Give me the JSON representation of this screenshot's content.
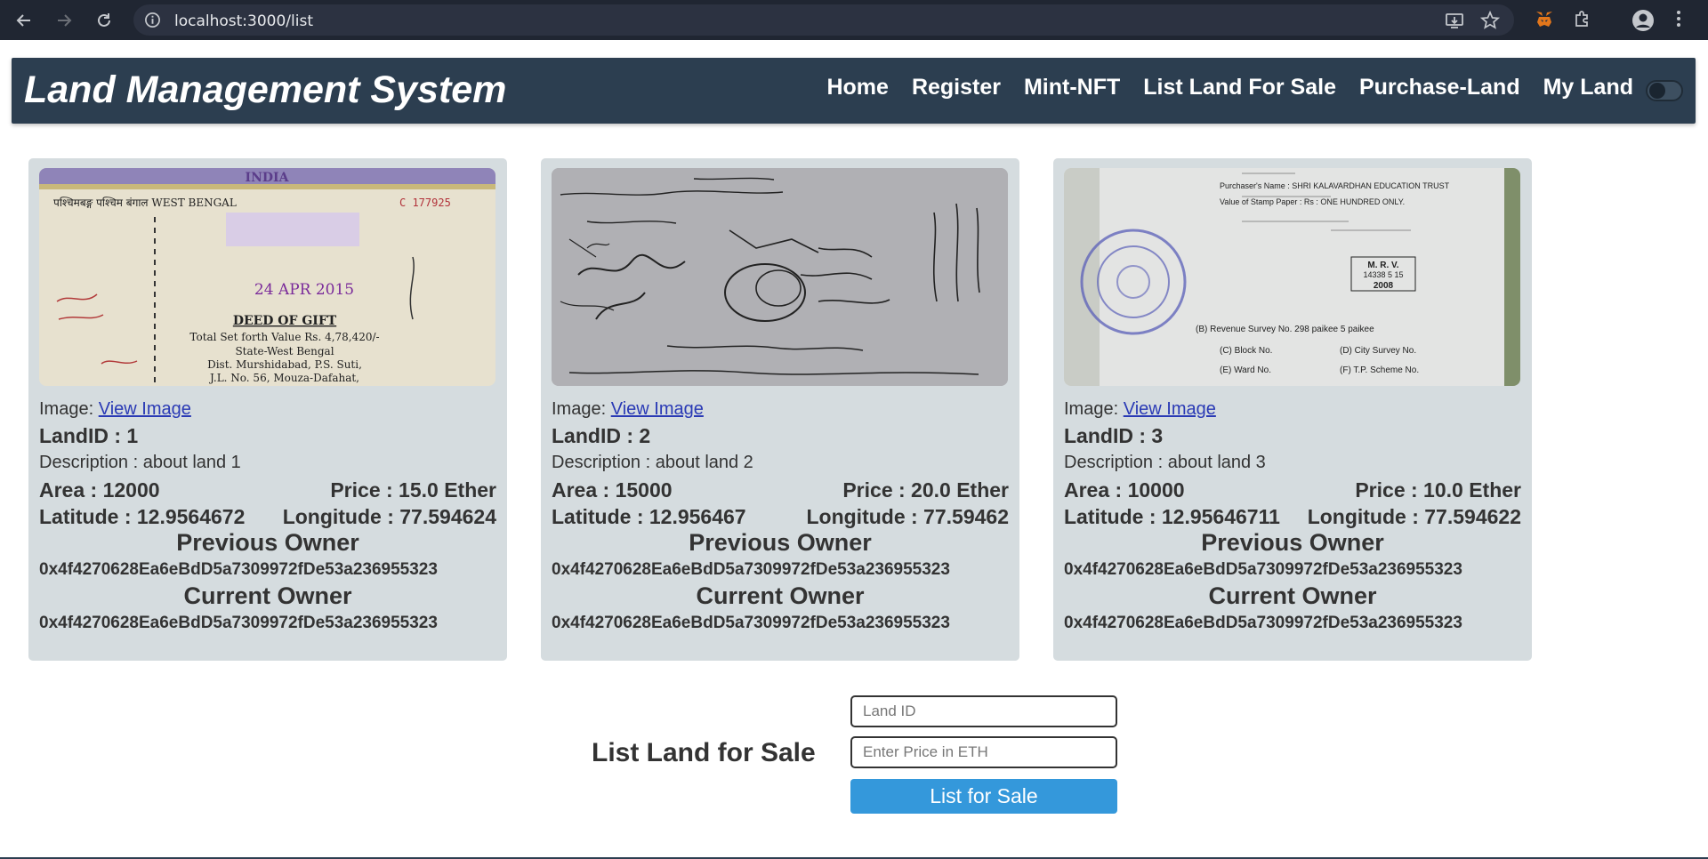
{
  "browser": {
    "url": "localhost:3000/list"
  },
  "header": {
    "title": "Land Management System",
    "nav": [
      "Home",
      "Register",
      "Mint-NFT",
      "List Land For Sale",
      "Purchase-Land",
      "My Land"
    ]
  },
  "cards": [
    {
      "image_label": "Image:",
      "image_link": "View Image",
      "land_id": "LandID : 1",
      "description": "Description : about land 1",
      "area": "Area : 12000",
      "price": "Price : 15.0 Ether",
      "latitude": "Latitude : 12.9564672",
      "longitude": "Longitude : 77.594624",
      "previous_owner_label": "Previous Owner",
      "previous_owner": "0x4f4270628Ea6eBdD5a7309972fDe53a236955323",
      "current_owner_label": "Current Owner",
      "current_owner": "0x4f4270628Ea6eBdD5a7309972fDe53a236955323"
    },
    {
      "image_label": "Image:",
      "image_link": "View Image",
      "land_id": "LandID : 2",
      "description": "Description : about land 2",
      "area": "Area : 15000",
      "price": "Price : 20.0 Ether",
      "latitude": "Latitude : 12.956467",
      "longitude": "Longitude : 77.59462",
      "previous_owner_label": "Previous Owner",
      "previous_owner": "0x4f4270628Ea6eBdD5a7309972fDe53a236955323",
      "current_owner_label": "Current Owner",
      "current_owner": "0x4f4270628Ea6eBdD5a7309972fDe53a236955323"
    },
    {
      "image_label": "Image:",
      "image_link": "View Image",
      "land_id": "LandID : 3",
      "description": "Description : about land 3",
      "area": "Area : 10000",
      "price": "Price : 10.0 Ether",
      "latitude": "Latitude : 12.95646711",
      "longitude": "Longitude : 77.594622",
      "previous_owner_label": "Previous Owner",
      "previous_owner": "0x4f4270628Ea6eBdD5a7309972fDe53a236955323",
      "current_owner_label": "Current Owner",
      "current_owner": "0x4f4270628Ea6eBdD5a7309972fDe53a236955323"
    }
  ],
  "image_text": {
    "c1_a": "पश्चिमबङ्ग पश्चिम बंगाल WEST BENGAL",
    "c1_b": "INDIA",
    "c1_c": "C 177925",
    "c1_d": "24 APR 2015",
    "c1_e": "DEED OF GIFT",
    "c1_f": "Total Set forth Value Rs. 4,78,420/-",
    "c1_g": "State-West Bengal",
    "c1_h": "Dist. Murshidabad, P.S. Suti,",
    "c1_i": "J.L. No. 56, Mouza-Dafahat,",
    "c3_a": "Purchaser's Name : SHRI KALAVARDHAN EDUCATION TRUST",
    "c3_b": "Value of Stamp Paper : Rs : ONE HUNDRED ONLY.",
    "c3_c": "M. R. V.",
    "c3_d": "14338 5 15",
    "c3_e": "2008",
    "c3_f": "(B)   Revenue Survey No. 298 paikee 5 paikee",
    "c3_g": "(C)   Block No.",
    "c3_h": "(D)   City Survey No.",
    "c3_i": "(E)   Ward No.",
    "c3_j": "(F)   T.P. Scheme No."
  },
  "list_form": {
    "title": "List Land for Sale",
    "land_id_placeholder": "Land ID",
    "price_placeholder": "Enter Price in ETH",
    "submit_label": "List for Sale"
  },
  "colors": {
    "header_bg": "#2c3e50",
    "card_bg": "#d5dcdf",
    "button_bg": "#3498db",
    "link": "#2a3ab5"
  }
}
